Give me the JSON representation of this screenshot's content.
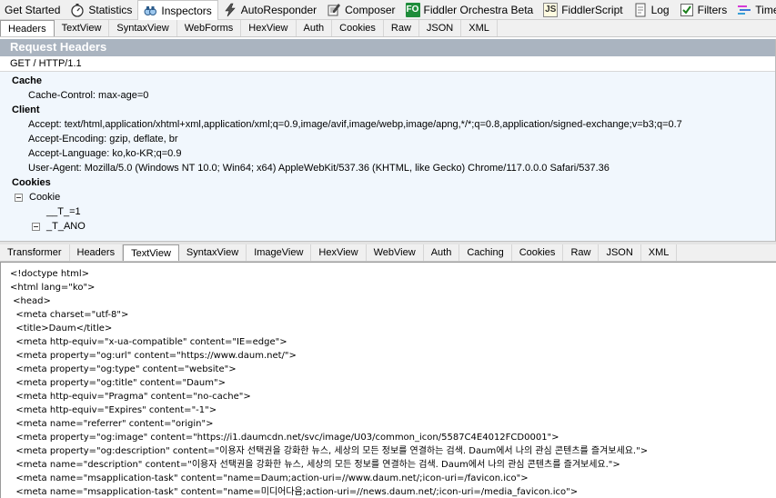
{
  "main_tabs": [
    {
      "label": "Get Started",
      "icon": ""
    },
    {
      "label": "Statistics",
      "icon": "stopwatch-icon"
    },
    {
      "label": "Inspectors",
      "icon": "inspectors-icon"
    },
    {
      "label": "AutoResponder",
      "icon": "lightning-icon"
    },
    {
      "label": "Composer",
      "icon": "composer-icon"
    },
    {
      "label": "Fiddler Orchestra Beta",
      "icon": "fo-icon"
    },
    {
      "label": "FiddlerScript",
      "icon": "js-icon"
    },
    {
      "label": "Log",
      "icon": "log-icon"
    },
    {
      "label": "Filters",
      "icon": "checkbox-icon"
    },
    {
      "label": "Timeline",
      "icon": "timeline-icon"
    }
  ],
  "fo_icon_text": "FO",
  "js_icon_text": "JS",
  "request_tabs": [
    "Headers",
    "TextView",
    "SyntaxView",
    "WebForms",
    "HexView",
    "Auth",
    "Cookies",
    "Raw",
    "JSON",
    "XML"
  ],
  "request": {
    "title": "Request Headers",
    "request_line": "GET / HTTP/1.1",
    "groups": {
      "cache": {
        "label": "Cache",
        "rows": [
          "Cache-Control: max-age=0"
        ]
      },
      "client": {
        "label": "Client",
        "rows": [
          "Accept: text/html,application/xhtml+xml,application/xml;q=0.9,image/avif,image/webp,image/apng,*/*;q=0.8,application/signed-exchange;v=b3;q=0.7",
          "Accept-Encoding: gzip, deflate, br",
          "Accept-Language: ko,ko-KR;q=0.9",
          "User-Agent: Mozilla/5.0 (Windows NT 10.0; Win64; x64) AppleWebKit/537.36 (KHTML, like Gecko) Chrome/117.0.0.0 Safari/537.36"
        ]
      },
      "cookies": {
        "label": "Cookies",
        "tree": {
          "root": "Cookie",
          "item1": "__T_=1",
          "item2": "_T_ANO"
        }
      }
    }
  },
  "response_tabs": [
    "Transformer",
    "Headers",
    "TextView",
    "SyntaxView",
    "ImageView",
    "HexView",
    "WebView",
    "Auth",
    "Caching",
    "Cookies",
    "Raw",
    "JSON",
    "XML"
  ],
  "response_lines": [
    "<!doctype html>",
    "<html lang=\"ko\">",
    " <head>",
    "  <meta charset=\"utf-8\">",
    "  <title>Daum</title>",
    "  <meta http-equiv=\"x-ua-compatible\" content=\"IE=edge\">",
    "  <meta property=\"og:url\" content=\"https://www.daum.net/\">",
    "  <meta property=\"og:type\" content=\"website\">",
    "  <meta property=\"og:title\" content=\"Daum\">",
    "  <meta http-equiv=\"Pragma\" content=\"no-cache\">",
    "  <meta http-equiv=\"Expires\" content=\"-1\">",
    "  <meta name=\"referrer\" content=\"origin\">",
    "  <meta property=\"og:image\" content=\"https://i1.daumcdn.net/svc/image/U03/common_icon/5587C4E4012FCD0001\">",
    "  <meta property=\"og:description\" content=\"이용자 선택권을 강화한 뉴스, 세상의 모든 정보를 연결하는 검색. Daum에서 나의 관심 콘텐츠를 즐겨보세요.\">",
    "  <meta name=\"description\" content=\"이용자 선택권을 강화한 뉴스, 세상의 모든 정보를 연결하는 검색. Daum에서 나의 관심 콘텐츠를 즐겨보세요.\">",
    "  <meta name=\"msapplication-task\" content=\"name=Daum;action-uri=//www.daum.net/;icon-uri=/favicon.ico\">",
    "  <meta name=\"msapplication-task\" content=\"name=미디어다음;action-uri=//news.daum.net/;icon-uri=/media_favicon.ico\">"
  ],
  "colors": {
    "request_title_bg": "#aab4c0",
    "headers_bg": "#f1f7fd",
    "tab_bg": "#f0f0f0",
    "fo_green": "#1e8c3a",
    "timeline_bar_1": "#d63ad6",
    "timeline_bar_2": "#3a7ad6",
    "timeline_bar_3": "#3aa0d6"
  }
}
